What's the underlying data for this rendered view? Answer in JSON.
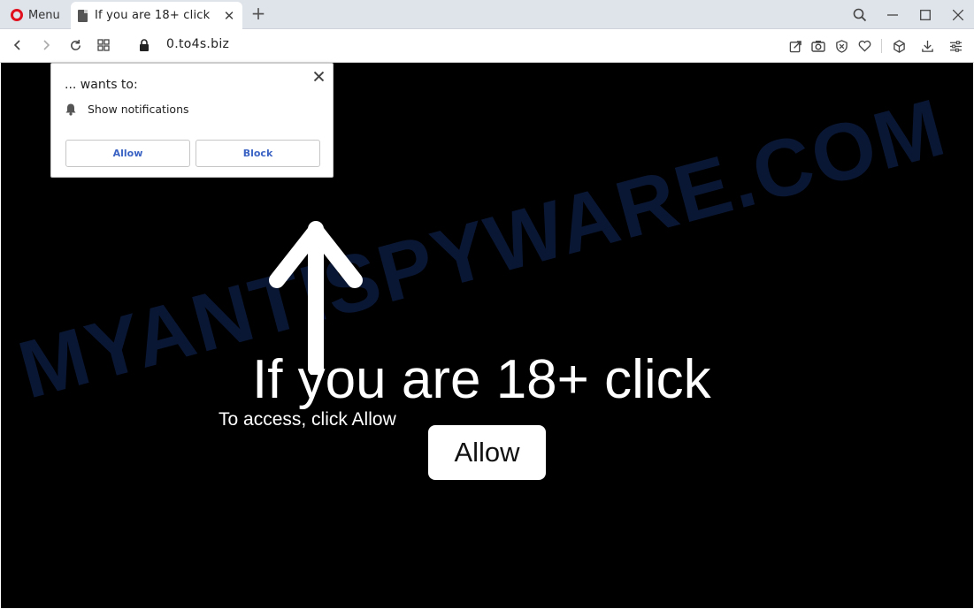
{
  "browser": {
    "menu_label": "Menu",
    "tab_title": "If you are 18+ click",
    "url": "0.to4s.biz"
  },
  "prompt": {
    "title": "... wants to:",
    "permission": "Show notifications",
    "allow_label": "Allow",
    "block_label": "Block"
  },
  "page": {
    "headline": "If you are 18+ click",
    "subtext": "To access, click Allow",
    "button_label": "Allow",
    "watermark": "MYANTISPYWARE.COM"
  },
  "colors": {
    "page_background": "#000000",
    "prompt_button_text": "#3b63c4",
    "opera_red": "#e0101e",
    "watermark": "#0c1a3a"
  }
}
